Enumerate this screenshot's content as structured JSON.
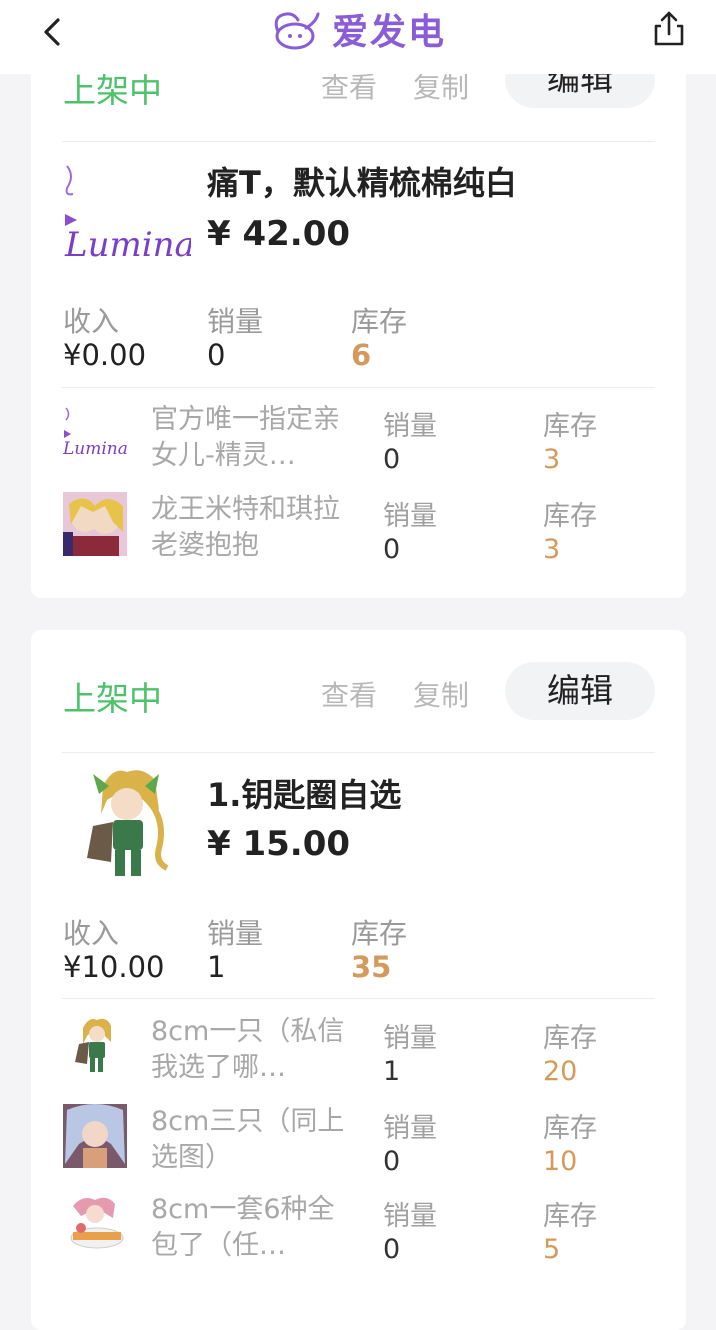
{
  "header": {
    "brand": "爱发电",
    "back_icon": "chevron-left-icon",
    "share_icon": "share-icon"
  },
  "cards": [
    {
      "status": "上架中",
      "actions": {
        "view": "查看",
        "copy": "复制",
        "edit": "编辑"
      },
      "product": {
        "name": "痛T，默认精梳棉纯白",
        "price": "¥ 42.00",
        "thumb_text": "Lumina"
      },
      "stats": {
        "income_label": "收入",
        "income": "¥0.00",
        "sales_label": "销量",
        "sales": "0",
        "stock_label": "库存",
        "stock": "6"
      },
      "variants": [
        {
          "name": "官方唯一指定亲女儿-精灵…",
          "sales_label": "销量",
          "sales": "0",
          "stock_label": "库存",
          "stock": "3"
        },
        {
          "name": "龙王米特和琪拉老婆抱抱",
          "sales_label": "销量",
          "sales": "0",
          "stock_label": "库存",
          "stock": "3"
        }
      ]
    },
    {
      "status": "上架中",
      "actions": {
        "view": "查看",
        "copy": "复制",
        "edit": "编辑"
      },
      "product": {
        "name": "1.钥匙圈自选",
        "price": "¥ 15.00"
      },
      "stats": {
        "income_label": "收入",
        "income": "¥10.00",
        "sales_label": "销量",
        "sales": "1",
        "stock_label": "库存",
        "stock": "35"
      },
      "variants": [
        {
          "name": "8cm一只（私信我选了哪…",
          "sales_label": "销量",
          "sales": "1",
          "stock_label": "库存",
          "stock": "20"
        },
        {
          "name": "8cm三只（同上选图）",
          "sales_label": "销量",
          "sales": "0",
          "stock_label": "库存",
          "stock": "10"
        },
        {
          "name": "8cm一套6种全包了（任…",
          "sales_label": "销量",
          "sales": "0",
          "stock_label": "库存",
          "stock": "5"
        }
      ]
    }
  ],
  "colors": {
    "brand": "#8a5cd8",
    "status_green": "#4cc36b",
    "stock_orange": "#d49a5c",
    "background": "#f4f4f6"
  }
}
